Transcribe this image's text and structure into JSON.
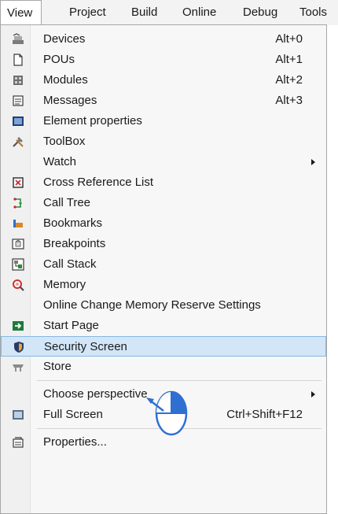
{
  "menubar": {
    "items": [
      {
        "label": "View"
      },
      {
        "label": "Project"
      },
      {
        "label": "Build"
      },
      {
        "label": "Online"
      },
      {
        "label": "Debug"
      },
      {
        "label": "Tools"
      }
    ],
    "active_index": 0
  },
  "menu": {
    "items": [
      {
        "label": "Devices",
        "shortcut": "Alt+0",
        "icon": "devices-icon"
      },
      {
        "label": "POUs",
        "shortcut": "Alt+1",
        "icon": "pous-icon"
      },
      {
        "label": "Modules",
        "shortcut": "Alt+2",
        "icon": "modules-icon"
      },
      {
        "label": "Messages",
        "shortcut": "Alt+3",
        "icon": "messages-icon"
      },
      {
        "label": "Element properties",
        "shortcut": "",
        "icon": "element-properties-icon"
      },
      {
        "label": "ToolBox",
        "shortcut": "",
        "icon": "toolbox-icon"
      },
      {
        "label": "Watch",
        "shortcut": "",
        "icon": "",
        "submenu": true
      },
      {
        "label": "Cross Reference List",
        "shortcut": "",
        "icon": "cross-reference-icon"
      },
      {
        "label": "Call Tree",
        "shortcut": "",
        "icon": "call-tree-icon"
      },
      {
        "label": "Bookmarks",
        "shortcut": "",
        "icon": "bookmarks-icon"
      },
      {
        "label": "Breakpoints",
        "shortcut": "",
        "icon": "breakpoints-icon"
      },
      {
        "label": "Call Stack",
        "shortcut": "",
        "icon": "call-stack-icon"
      },
      {
        "label": "Memory",
        "shortcut": "",
        "icon": "memory-icon"
      },
      {
        "label": "Online Change Memory Reserve Settings",
        "shortcut": "",
        "icon": ""
      },
      {
        "label": "Start Page",
        "shortcut": "",
        "icon": "start-page-icon"
      },
      {
        "label": "Security Screen",
        "shortcut": "",
        "icon": "security-shield-icon",
        "highlighted": true
      },
      {
        "label": "Store",
        "shortcut": "",
        "icon": "store-icon"
      },
      {
        "label": "Choose perspective",
        "shortcut": "",
        "icon": "",
        "submenu": true
      },
      {
        "label": "Full Screen",
        "shortcut": "Ctrl+Shift+F12",
        "icon": "full-screen-icon"
      },
      {
        "label": "Properties...",
        "shortcut": "",
        "icon": "properties-icon"
      }
    ]
  },
  "colors": {
    "highlight_bg": "#d2e6f8",
    "highlight_border": "#86b8e4",
    "pointer_accent": "#2f6fd1"
  }
}
